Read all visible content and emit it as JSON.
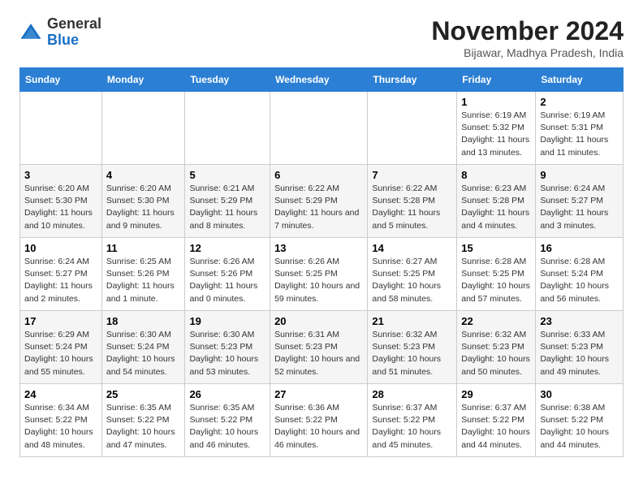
{
  "logo": {
    "line1": "General",
    "line2": "Blue"
  },
  "title": "November 2024",
  "subtitle": "Bijawar, Madhya Pradesh, India",
  "weekdays": [
    "Sunday",
    "Monday",
    "Tuesday",
    "Wednesday",
    "Thursday",
    "Friday",
    "Saturday"
  ],
  "weeks": [
    [
      {
        "day": "",
        "info": ""
      },
      {
        "day": "",
        "info": ""
      },
      {
        "day": "",
        "info": ""
      },
      {
        "day": "",
        "info": ""
      },
      {
        "day": "",
        "info": ""
      },
      {
        "day": "1",
        "info": "Sunrise: 6:19 AM\nSunset: 5:32 PM\nDaylight: 11 hours\nand 13 minutes."
      },
      {
        "day": "2",
        "info": "Sunrise: 6:19 AM\nSunset: 5:31 PM\nDaylight: 11 hours\nand 11 minutes."
      }
    ],
    [
      {
        "day": "3",
        "info": "Sunrise: 6:20 AM\nSunset: 5:30 PM\nDaylight: 11 hours\nand 10 minutes."
      },
      {
        "day": "4",
        "info": "Sunrise: 6:20 AM\nSunset: 5:30 PM\nDaylight: 11 hours\nand 9 minutes."
      },
      {
        "day": "5",
        "info": "Sunrise: 6:21 AM\nSunset: 5:29 PM\nDaylight: 11 hours\nand 8 minutes."
      },
      {
        "day": "6",
        "info": "Sunrise: 6:22 AM\nSunset: 5:29 PM\nDaylight: 11 hours\nand 7 minutes."
      },
      {
        "day": "7",
        "info": "Sunrise: 6:22 AM\nSunset: 5:28 PM\nDaylight: 11 hours\nand 5 minutes."
      },
      {
        "day": "8",
        "info": "Sunrise: 6:23 AM\nSunset: 5:28 PM\nDaylight: 11 hours\nand 4 minutes."
      },
      {
        "day": "9",
        "info": "Sunrise: 6:24 AM\nSunset: 5:27 PM\nDaylight: 11 hours\nand 3 minutes."
      }
    ],
    [
      {
        "day": "10",
        "info": "Sunrise: 6:24 AM\nSunset: 5:27 PM\nDaylight: 11 hours\nand 2 minutes."
      },
      {
        "day": "11",
        "info": "Sunrise: 6:25 AM\nSunset: 5:26 PM\nDaylight: 11 hours\nand 1 minute."
      },
      {
        "day": "12",
        "info": "Sunrise: 6:26 AM\nSunset: 5:26 PM\nDaylight: 11 hours\nand 0 minutes."
      },
      {
        "day": "13",
        "info": "Sunrise: 6:26 AM\nSunset: 5:25 PM\nDaylight: 10 hours\nand 59 minutes."
      },
      {
        "day": "14",
        "info": "Sunrise: 6:27 AM\nSunset: 5:25 PM\nDaylight: 10 hours\nand 58 minutes."
      },
      {
        "day": "15",
        "info": "Sunrise: 6:28 AM\nSunset: 5:25 PM\nDaylight: 10 hours\nand 57 minutes."
      },
      {
        "day": "16",
        "info": "Sunrise: 6:28 AM\nSunset: 5:24 PM\nDaylight: 10 hours\nand 56 minutes."
      }
    ],
    [
      {
        "day": "17",
        "info": "Sunrise: 6:29 AM\nSunset: 5:24 PM\nDaylight: 10 hours\nand 55 minutes."
      },
      {
        "day": "18",
        "info": "Sunrise: 6:30 AM\nSunset: 5:24 PM\nDaylight: 10 hours\nand 54 minutes."
      },
      {
        "day": "19",
        "info": "Sunrise: 6:30 AM\nSunset: 5:23 PM\nDaylight: 10 hours\nand 53 minutes."
      },
      {
        "day": "20",
        "info": "Sunrise: 6:31 AM\nSunset: 5:23 PM\nDaylight: 10 hours\nand 52 minutes."
      },
      {
        "day": "21",
        "info": "Sunrise: 6:32 AM\nSunset: 5:23 PM\nDaylight: 10 hours\nand 51 minutes."
      },
      {
        "day": "22",
        "info": "Sunrise: 6:32 AM\nSunset: 5:23 PM\nDaylight: 10 hours\nand 50 minutes."
      },
      {
        "day": "23",
        "info": "Sunrise: 6:33 AM\nSunset: 5:23 PM\nDaylight: 10 hours\nand 49 minutes."
      }
    ],
    [
      {
        "day": "24",
        "info": "Sunrise: 6:34 AM\nSunset: 5:22 PM\nDaylight: 10 hours\nand 48 minutes."
      },
      {
        "day": "25",
        "info": "Sunrise: 6:35 AM\nSunset: 5:22 PM\nDaylight: 10 hours\nand 47 minutes."
      },
      {
        "day": "26",
        "info": "Sunrise: 6:35 AM\nSunset: 5:22 PM\nDaylight: 10 hours\nand 46 minutes."
      },
      {
        "day": "27",
        "info": "Sunrise: 6:36 AM\nSunset: 5:22 PM\nDaylight: 10 hours\nand 46 minutes."
      },
      {
        "day": "28",
        "info": "Sunrise: 6:37 AM\nSunset: 5:22 PM\nDaylight: 10 hours\nand 45 minutes."
      },
      {
        "day": "29",
        "info": "Sunrise: 6:37 AM\nSunset: 5:22 PM\nDaylight: 10 hours\nand 44 minutes."
      },
      {
        "day": "30",
        "info": "Sunrise: 6:38 AM\nSunset: 5:22 PM\nDaylight: 10 hours\nand 44 minutes."
      }
    ]
  ]
}
